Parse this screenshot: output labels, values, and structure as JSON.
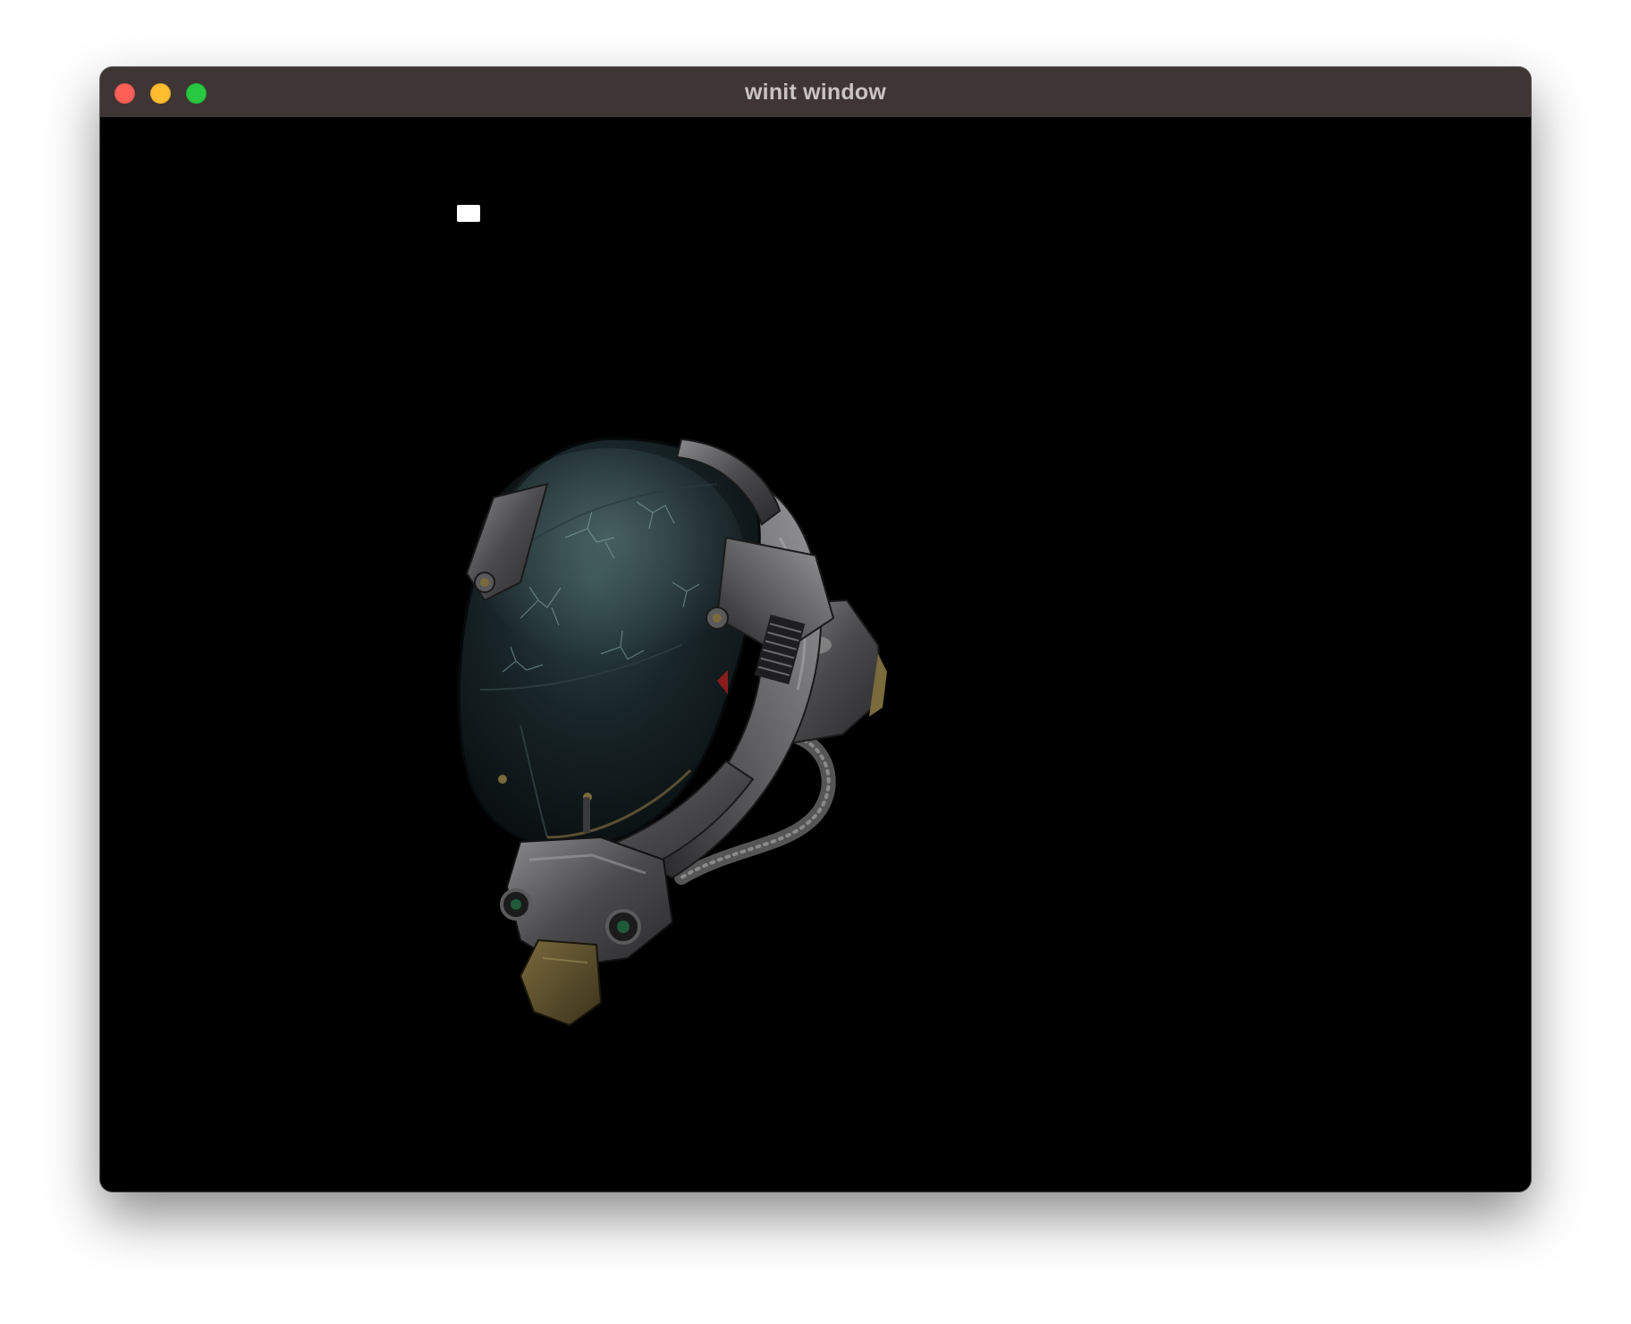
{
  "window": {
    "title": "winit window",
    "controls": {
      "close_color": "#fe5f57",
      "minimize_color": "#febc2e",
      "maximize_color": "#28c840"
    }
  },
  "viewport": {
    "background": "#000000",
    "scene": {
      "object": "helmet-model",
      "light_marker": "light-marker"
    }
  }
}
